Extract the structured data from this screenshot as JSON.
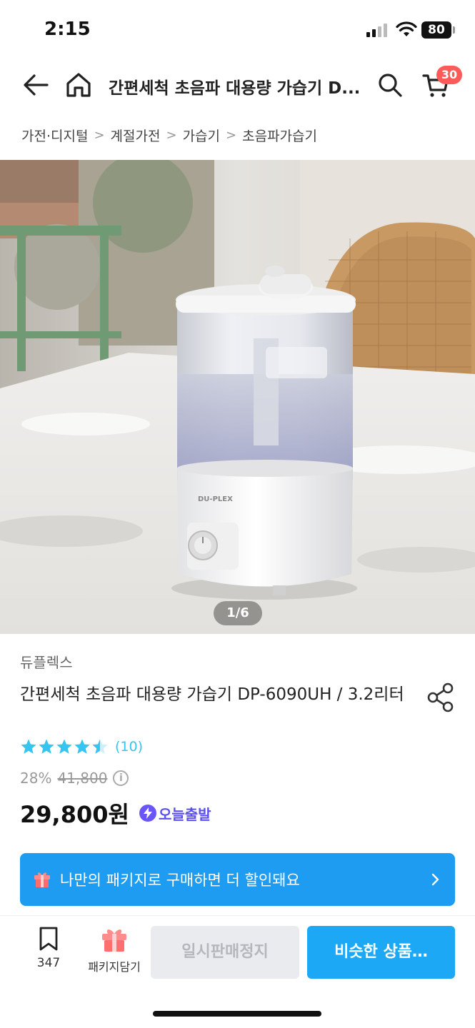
{
  "status_bar": {
    "time": "2:15",
    "battery": "80"
  },
  "header": {
    "title": "간편세척 초음파 대용량 가습기 D...",
    "cart_count": "30"
  },
  "breadcrumb": [
    "가전·디지털",
    "계절가전",
    "가습기",
    "초음파가습기"
  ],
  "gallery": {
    "counter": "1/6",
    "device_brand_text": "DU-PLEX"
  },
  "product": {
    "brand": "듀플렉스",
    "name": "간편세척 초음파 대용량 가습기 DP-6090UH / 3.2리터",
    "rating": 4.5,
    "review_count": "(10)",
    "discount": "28%",
    "original_price": "41,800",
    "price": "29,800원",
    "shipping_badge": "오늘출발"
  },
  "banner": {
    "text": "나만의 패키지로 구매하면 더 할인돼요"
  },
  "bottom_bar": {
    "bookmark_count": "347",
    "package_label": "패키지담기",
    "soldout_label": "일시판매정지",
    "similar_label": "비슷한 상품…"
  },
  "colors": {
    "accent": "#1e9cf2",
    "rating_star": "#35c5f0",
    "cart_badge": "#ff5a5a",
    "shipping_badge": "#5b4ff0",
    "disabled_button": "#e9ebee"
  },
  "icons": [
    "back-arrow-icon",
    "home-icon",
    "search-icon",
    "cart-icon",
    "share-icon",
    "star-icon",
    "info-icon",
    "bolt-icon",
    "gift-box-icon",
    "chevron-right-icon",
    "bookmark-icon"
  ]
}
